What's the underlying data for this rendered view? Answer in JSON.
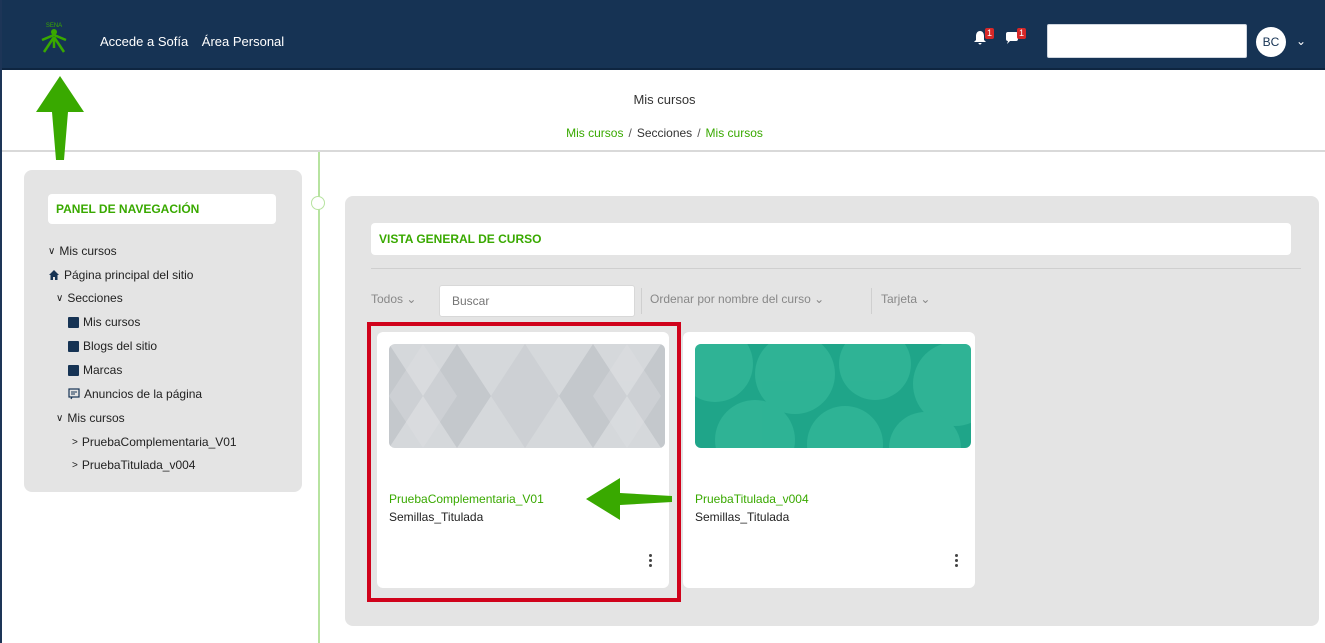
{
  "navbar": {
    "brand": "SENA",
    "links": [
      "Accede a Sofía",
      "Área Personal"
    ],
    "notifications_count": "1",
    "messages_count": "1",
    "avatar_initials": "BC",
    "avatar_caret": "⌄",
    "colors": {
      "bar": "#163354",
      "accent": "#39a900"
    }
  },
  "header": {
    "title": "Mis cursos",
    "breadcrumb": [
      "Mis cursos",
      "Secciones",
      "Mis cursos"
    ],
    "separator": "/"
  },
  "nav_panel": {
    "title": "PANEL DE NAVEGACIÓN",
    "items": [
      {
        "label": "Mis cursos",
        "icon": "chevron-down-icon"
      },
      {
        "label": "Página principal del sitio",
        "icon": "home-icon"
      },
      {
        "label": "Secciones",
        "icon": "chevron-down-icon"
      },
      {
        "label": "Mis cursos",
        "icon": "square-icon"
      },
      {
        "label": "Blogs del sitio",
        "icon": "square-icon"
      },
      {
        "label": "Marcas",
        "icon": "square-icon"
      },
      {
        "label": "Anuncios de la página",
        "icon": "announcement-icon"
      },
      {
        "label": "Mis cursos",
        "icon": "chevron-down-icon"
      },
      {
        "label": "PruebaComplementaria_V01",
        "icon": "chevron-right-icon"
      },
      {
        "label": "PruebaTitulada_v004",
        "icon": "chevron-right-icon"
      }
    ]
  },
  "overview": {
    "title": "VISTA GENERAL DE CURSO",
    "filter": "Todos",
    "search_placeholder": "Buscar",
    "sort": "Ordenar por nombre del curso",
    "view": "Tarjeta",
    "dropdown_caret": "⌄",
    "courses": [
      {
        "name": "PruebaComplementaria_V01",
        "category": "Semillas_Titulada",
        "image_color": "#d5d8db"
      },
      {
        "name": "PruebaTitulada_v004",
        "category": "Semillas_Titulada",
        "image_color": "#1fa589"
      }
    ]
  }
}
